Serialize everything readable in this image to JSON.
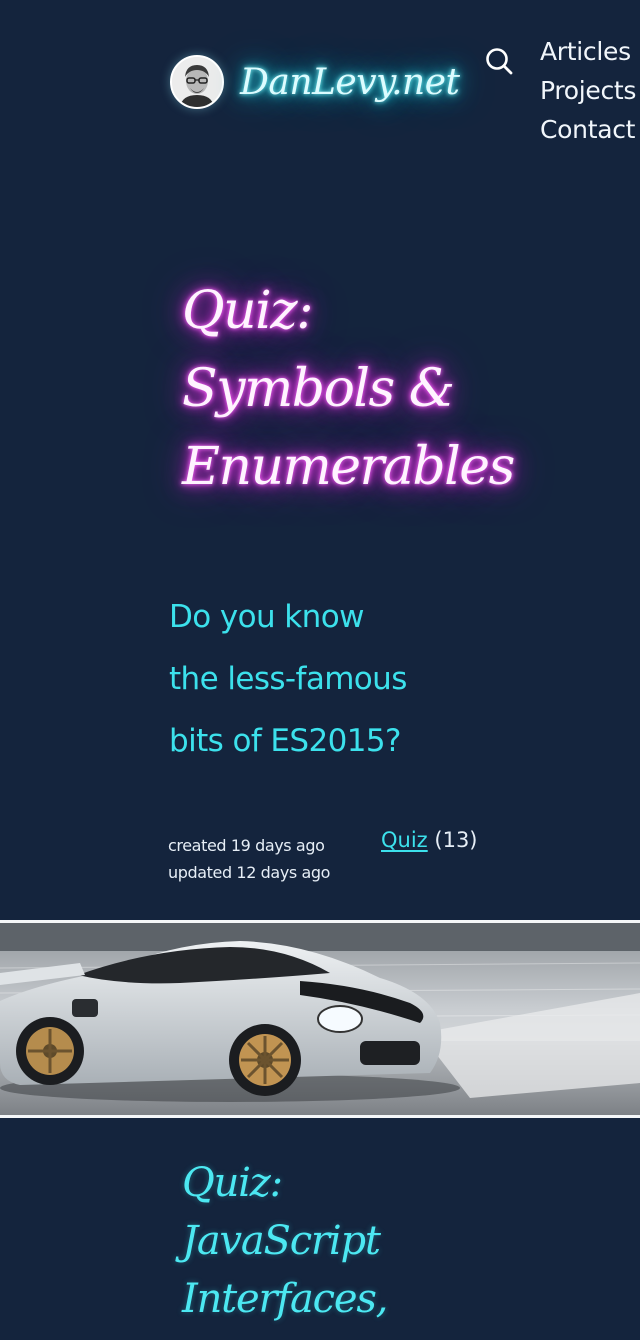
{
  "header": {
    "site_name": "DanLevy.net",
    "avatar_icon": "avatar-photo",
    "search_icon": "search-icon",
    "nav": [
      "Articles",
      "Projects",
      "Contact"
    ]
  },
  "article": {
    "title_lines": [
      "Quiz:",
      "Symbols &",
      "Enumerables"
    ],
    "subtitle_lines": [
      "Do you know",
      "the less-famous",
      "bits of ES2015?"
    ],
    "created": "created 19 days ago",
    "updated": "updated 12 days ago",
    "tag": {
      "label": "Quiz",
      "count": "(13)"
    }
  },
  "banner": {
    "image_icon": "sports-car-image"
  },
  "next_article": {
    "title_lines": [
      "Quiz:",
      "JavaScript",
      "Interfaces,"
    ]
  },
  "colors": {
    "background": "#14243d",
    "cyan_accent": "#3ce1ec",
    "magenta_glow": "#e93be8",
    "text_light": "#e6eef6"
  }
}
